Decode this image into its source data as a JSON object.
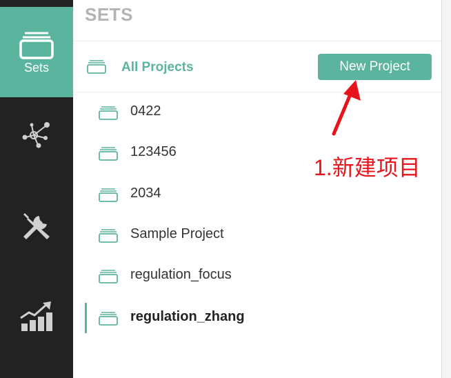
{
  "sidebar": {
    "items": [
      {
        "label": "Sets",
        "icon": "folder-icon",
        "active": true
      },
      {
        "label": "",
        "icon": "network-icon",
        "active": false
      },
      {
        "label": "",
        "icon": "tools-icon",
        "active": false
      },
      {
        "label": "",
        "icon": "chart-trend-icon",
        "active": false
      }
    ]
  },
  "header": {
    "title": "SETS"
  },
  "all_projects": {
    "label": "All Projects"
  },
  "new_project_button": {
    "label": "New Project"
  },
  "projects": [
    {
      "name": "0422",
      "selected": false
    },
    {
      "name": "123456",
      "selected": false
    },
    {
      "name": "2034",
      "selected": false
    },
    {
      "name": "Sample Project",
      "selected": false
    },
    {
      "name": "regulation_focus",
      "selected": false
    },
    {
      "name": "regulation_zhang",
      "selected": true
    }
  ],
  "annotation": {
    "text": "1.新建项目",
    "color": "#e8141b"
  },
  "colors": {
    "accent": "#5bb49e",
    "rail": "#222222"
  }
}
